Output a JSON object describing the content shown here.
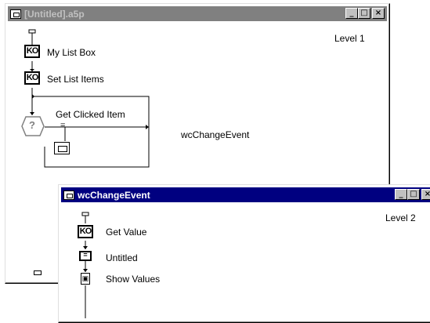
{
  "window1": {
    "title": "[Untitled].a5p",
    "level": "Level 1",
    "buttons": {
      "minimize": "_",
      "maximize": "□",
      "close": "×"
    },
    "icons": [
      {
        "label": "My List Box",
        "icon": "knowledge-object-icon",
        "glyph": "KO"
      },
      {
        "label": "Set List Items",
        "icon": "knowledge-object-icon",
        "glyph": "KO"
      }
    ],
    "decision": {
      "label": "Get Clicked Item",
      "glyph": "?"
    },
    "decision_branch": {
      "glyph": "="
    },
    "map_label": "wcChangeEvent"
  },
  "window2": {
    "title": "wcChangeEvent",
    "level": "Level 2",
    "buttons": {
      "minimize": "_",
      "maximize": "□",
      "close": "×"
    },
    "icons": [
      {
        "label": "Get Value",
        "icon": "knowledge-object-icon",
        "glyph": "KO"
      },
      {
        "label": "Untitled",
        "icon": "calculation-icon",
        "glyph": "="
      },
      {
        "label": "Show Values",
        "icon": "display-icon",
        "glyph": "▣"
      }
    ]
  }
}
